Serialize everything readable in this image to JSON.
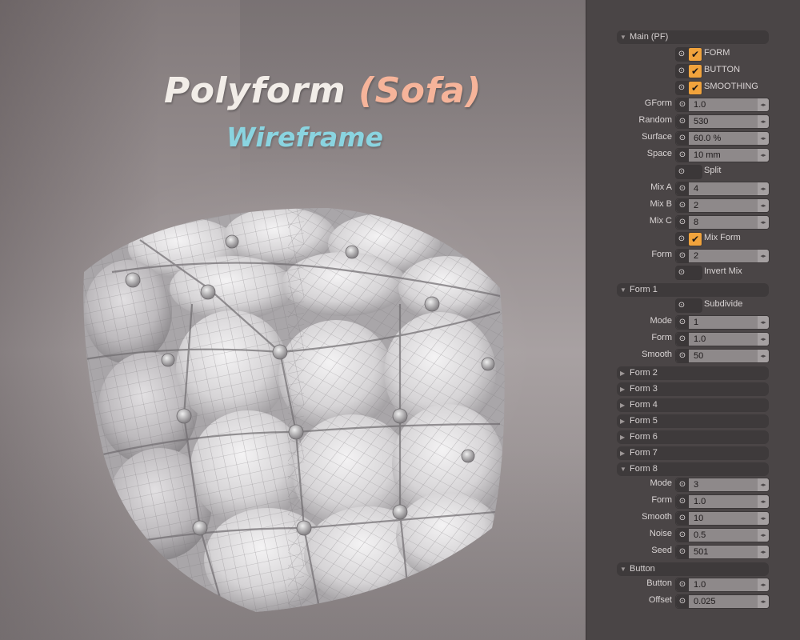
{
  "viewport": {
    "title_word": "Polyform",
    "title_accent": "(Sofa)",
    "subtitle": "Wireframe"
  },
  "panel": {
    "main_section": "Main (PF)",
    "form_check": "FORM",
    "button_check": "BUTTON",
    "smoothing_check": "SMOOTHING",
    "gform_label": "GForm",
    "gform_value": "1.0",
    "random_label": "Random",
    "random_value": "530",
    "surface_label": "Surface",
    "surface_value": "60.0 %",
    "space_label": "Space",
    "space_value": "10 mm",
    "split_check": "Split",
    "mixa_label": "Mix A",
    "mixa_value": "4",
    "mixb_label": "Mix B",
    "mixb_value": "2",
    "mixc_label": "Mix C",
    "mixc_value": "8",
    "mixform_check": "Mix Form",
    "form_label": "Form",
    "form_value": "2",
    "invertmix_check": "Invert Mix",
    "form1_section": "Form 1",
    "subdivide_check": "Subdivide",
    "f1_mode_label": "Mode",
    "f1_mode_value": "1",
    "f1_form_label": "Form",
    "f1_form_value": "1.0",
    "f1_smooth_label": "Smooth",
    "f1_smooth_value": "50",
    "form2_section": "Form 2",
    "form3_section": "Form 3",
    "form4_section": "Form 4",
    "form5_section": "Form 5",
    "form6_section": "Form 6",
    "form7_section": "Form 7",
    "form8_section": "Form 8",
    "f8_mode_label": "Mode",
    "f8_mode_value": "3",
    "f8_form_label": "Form",
    "f8_form_value": "1.0",
    "f8_smooth_label": "Smooth",
    "f8_smooth_value": "10",
    "f8_noise_label": "Noise",
    "f8_noise_value": "0.5",
    "f8_seed_label": "Seed",
    "f8_seed_value": "501",
    "button_section": "Button",
    "btn_button_label": "Button",
    "btn_button_value": "1.0",
    "btn_offset_label": "Offset",
    "btn_offset_value": "0.025"
  },
  "icons": {
    "reset": "reset-icon",
    "check": "checkmark-icon",
    "spin": "spin-arrows-icon",
    "expanded": "triangle-down-icon",
    "collapsed": "triangle-right-icon"
  },
  "colors": {
    "panel_bg": "#4a4546",
    "check_on": "#f1a33c",
    "title": "#f2ede8",
    "title_accent": "#f6b49a",
    "subtitle": "#8ad4e0"
  }
}
